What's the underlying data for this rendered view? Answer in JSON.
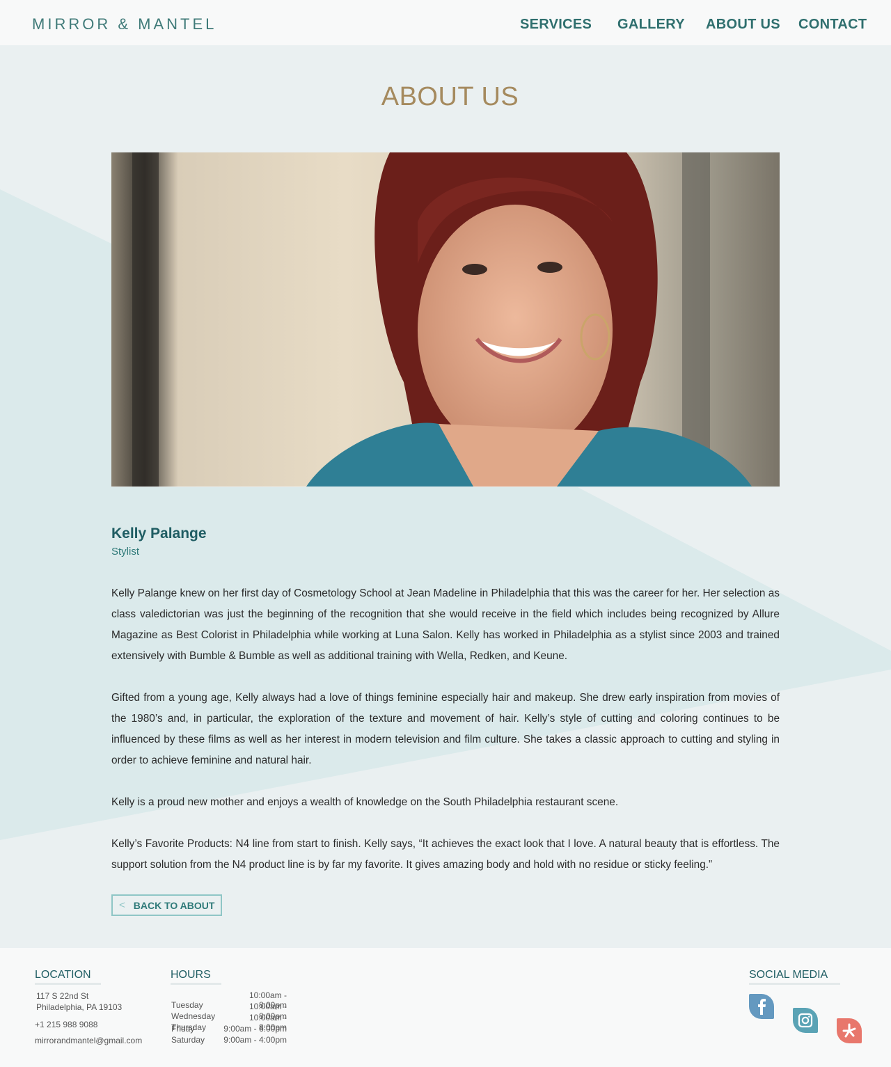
{
  "brand": {
    "logo": "MIRROR & MANTEL"
  },
  "nav": {
    "services": "SERVICES",
    "gallery": "GALLERY",
    "about": "ABOUT US",
    "contact": "CONTACT"
  },
  "page": {
    "title": "ABOUT US"
  },
  "profile": {
    "name": "Kelly Palange",
    "role": "Stylist",
    "paragraphs": [
      "Kelly Palange knew on her first day of Cosmetology School at Jean Madeline in Philadelphia that this was the career for her. Her selection as class valedictorian was just the beginning of the recognition that she would receive in the field which includes being recognized by Allure Magazine as Best Colorist in Philadelphia while working at Luna Salon. Kelly has worked in Philadelphia as a stylist since 2003 and trained extensively with Bumble & Bumble as well as additional training with Wella, Redken, and Keune.",
      "Gifted from a young age, Kelly always had a love of things feminine especially hair and makeup. She drew early inspiration from movies of the 1980’s and, in particular, the exploration of the texture and movement of hair. Kelly’s style of cutting and coloring continues to be influenced by these films as well as her interest in modern television and film culture. She takes a classic approach to cutting and styling in order to achieve feminine and natural hair.",
      "Kelly is a proud new mother and enjoys a wealth of knowledge on the South Philadelphia restaurant scene.",
      "Kelly’s Favorite Products: N4 line from start to finish. Kelly says, “It achieves the exact look that I love. A natural beauty that is effortless. The support solution from the N4 product line is by far my favorite. It gives amazing body and hold with no residue or sticky feeling.”"
    ],
    "back_label": "BACK TO ABOUT",
    "back_icon": "<"
  },
  "footer": {
    "location": {
      "heading": "LOCATION",
      "street": "117 S 22nd St",
      "city": "Philadelphia, PA 19103",
      "phone": "+1 215 988 9088",
      "email": "mirrorandmantel@gmail.com"
    },
    "hours": {
      "heading": "HOURS",
      "rows": [
        {
          "day": "Tuesday",
          "time": "10:00am - 8:00pm"
        },
        {
          "day": "Wednesday",
          "time": "10:00am - 8:00pm"
        },
        {
          "day": "Thursday",
          "time": "10:00am - 8:00pm"
        },
        {
          "day": "Friday",
          "time": "9:00am - 6:00pm"
        },
        {
          "day": "Saturday",
          "time": "9:00am - 4:00pm"
        }
      ]
    },
    "social": {
      "heading": "SOCIAL MEDIA",
      "icons": [
        "facebook-icon",
        "instagram-icon",
        "yelp-icon"
      ]
    }
  },
  "colors": {
    "accent_teal": "#2f6f6e",
    "title_gold": "#a58a5e",
    "facebook": "#6499c0",
    "instagram": "#5aa3b5",
    "yelp": "#e8776c"
  }
}
